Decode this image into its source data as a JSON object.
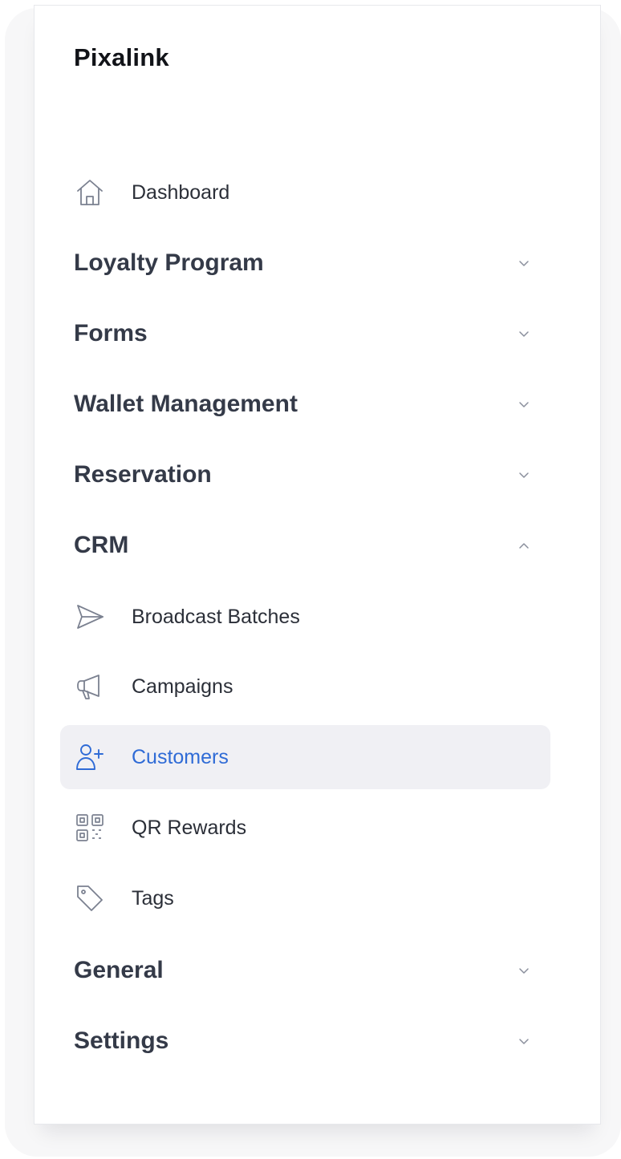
{
  "brand": {
    "name": "Pixalink"
  },
  "colors": {
    "accent": "#2f6bd6",
    "active_bg": "#f0f0f4",
    "text": "#343a48"
  },
  "nav": {
    "dashboard": {
      "label": "Dashboard",
      "icon": "home-icon"
    },
    "loyalty_program": {
      "label": "Loyalty Program",
      "expanded": false
    },
    "forms": {
      "label": "Forms",
      "expanded": false
    },
    "wallet_management": {
      "label": "Wallet Management",
      "expanded": false
    },
    "reservation": {
      "label": "Reservation",
      "expanded": false
    },
    "crm": {
      "label": "CRM",
      "expanded": true,
      "items": {
        "broadcast_batches": {
          "label": "Broadcast Batches",
          "icon": "send-icon"
        },
        "campaigns": {
          "label": "Campaigns",
          "icon": "megaphone-icon"
        },
        "customers": {
          "label": "Customers",
          "icon": "user-plus-icon",
          "active": true
        },
        "qr_rewards": {
          "label": "QR Rewards",
          "icon": "qr-code-icon"
        },
        "tags": {
          "label": "Tags",
          "icon": "tag-icon"
        }
      }
    },
    "general": {
      "label": "General",
      "expanded": false
    },
    "settings": {
      "label": "Settings",
      "expanded": false
    }
  }
}
